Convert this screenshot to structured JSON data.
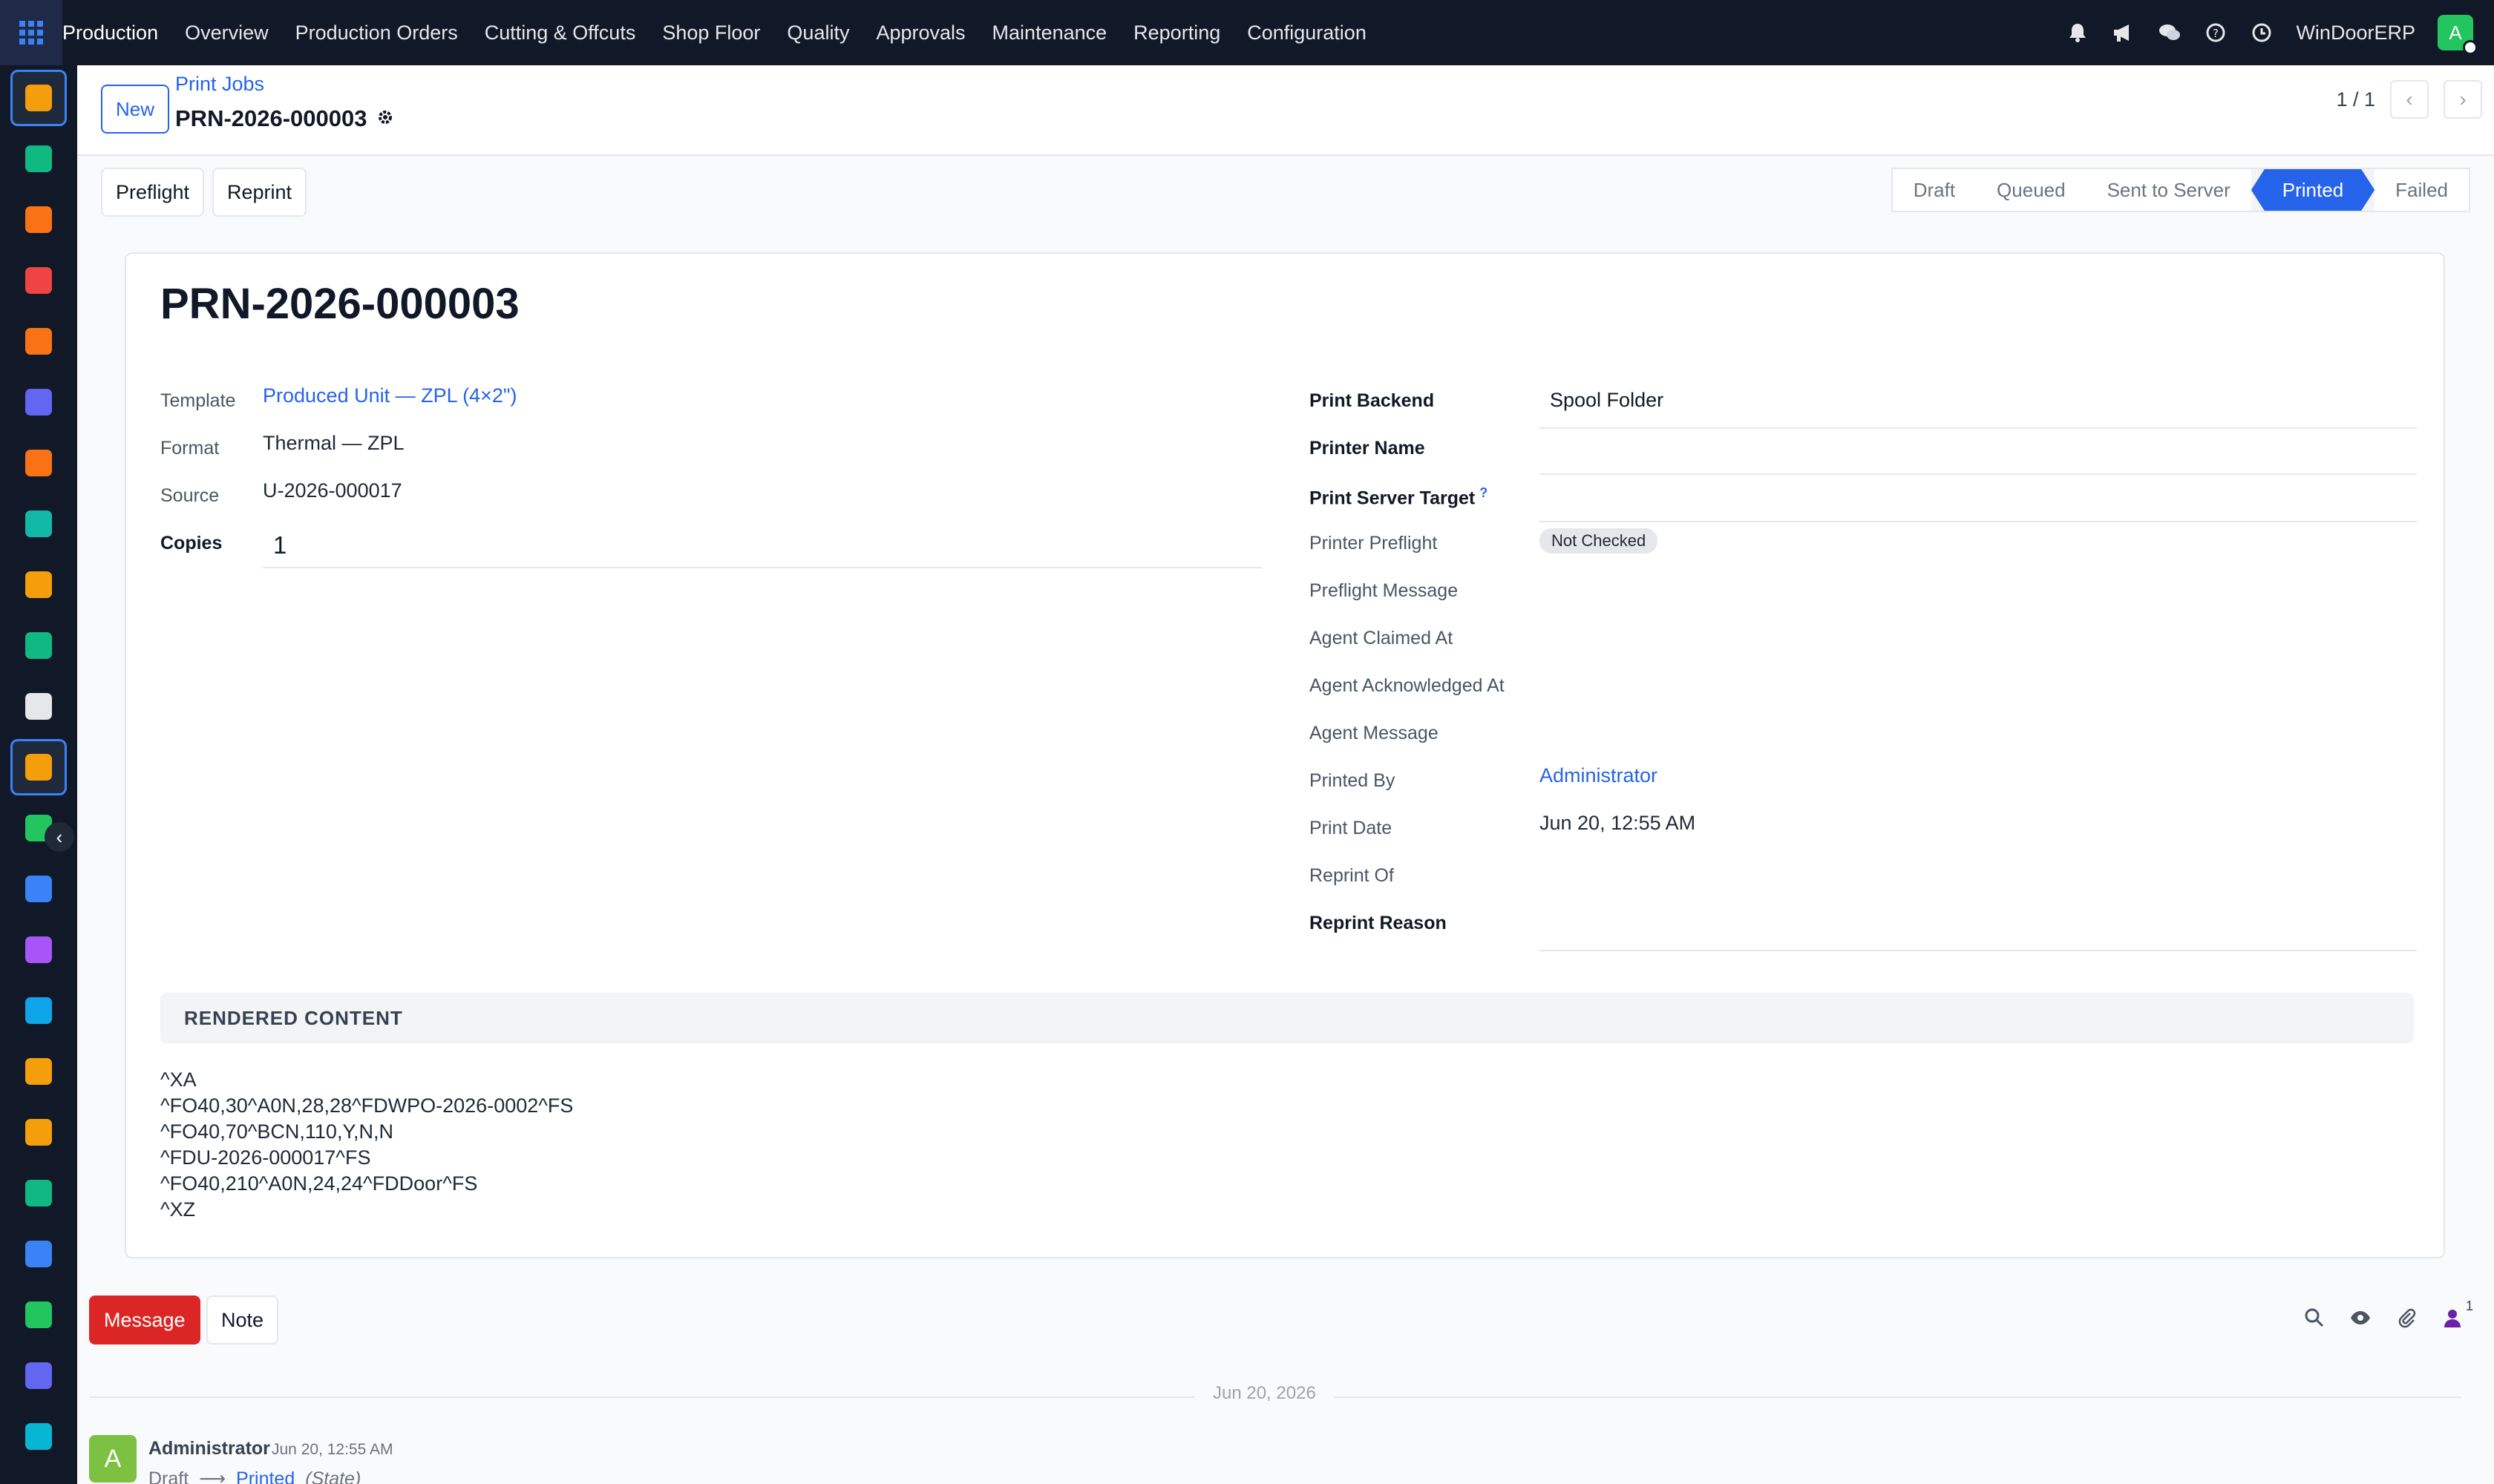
{
  "navbar": {
    "brand": "Production",
    "menu": [
      "Overview",
      "Production Orders",
      "Cutting & Offcuts",
      "Shop Floor",
      "Quality",
      "Approvals",
      "Maintenance",
      "Reporting",
      "Configuration"
    ],
    "company": "WinDoorERP",
    "user_initial": "A"
  },
  "dock": {
    "apps": [
      {
        "icon": "production-app-icon",
        "color": "#f59e0b"
      },
      {
        "icon": "contacts-app-icon",
        "color": "#10b981"
      },
      {
        "icon": "reporting-app-icon",
        "color": "#f97316"
      },
      {
        "icon": "dashboard-app-icon",
        "color": "#ef4444"
      },
      {
        "icon": "discuss-app-icon",
        "color": "#f97316"
      },
      {
        "icon": "mail-app-icon",
        "color": "#6366f1"
      },
      {
        "icon": "chat-app-icon",
        "color": "#f97316"
      },
      {
        "icon": "quality-app-icon",
        "color": "#14b8a6"
      },
      {
        "icon": "stats-app-icon",
        "color": "#f59e0b"
      },
      {
        "icon": "employees-app-icon",
        "color": "#10b981"
      },
      {
        "icon": "inventory-app-icon",
        "color": "#e5e7eb"
      },
      {
        "icon": "print-app-icon",
        "color": "#f59e0b"
      },
      {
        "icon": "todo-app-icon",
        "color": "#22c55e"
      },
      {
        "icon": "knowledge-app-icon",
        "color": "#3b82f6"
      },
      {
        "icon": "packages-app-icon",
        "color": "#a855f7"
      },
      {
        "icon": "invoicing-app-icon",
        "color": "#0ea5e9"
      },
      {
        "icon": "team-app-icon",
        "color": "#f59e0b"
      },
      {
        "icon": "calendar-app-icon",
        "color": "#f59e0b"
      },
      {
        "icon": "sign-app-icon",
        "color": "#10b981"
      },
      {
        "icon": "apps-app-icon",
        "color": "#3b82f6"
      },
      {
        "icon": "whatsapp-app-icon",
        "color": "#22c55e"
      },
      {
        "icon": "timer-app-icon",
        "color": "#6366f1"
      },
      {
        "icon": "website-app-icon",
        "color": "#06b6d4"
      }
    ]
  },
  "control_panel": {
    "new_label": "New",
    "breadcrumb": "Print Jobs",
    "record_name": "PRN-2026-000003",
    "pager": "1 / 1"
  },
  "actions": {
    "preflight_label": "Preflight",
    "reprint_label": "Reprint"
  },
  "statusbar": {
    "stages": [
      "Draft",
      "Queued",
      "Sent to Server",
      "Printed",
      "Failed"
    ],
    "current": "Printed"
  },
  "form": {
    "title": "PRN-2026-000003",
    "left": {
      "template_label": "Template",
      "template_value": "Produced Unit — ZPL (4×2\")",
      "format_label": "Format",
      "format_value": "Thermal — ZPL",
      "source_label": "Source",
      "source_value": "U-2026-000017",
      "copies_label": "Copies",
      "copies_value": "1"
    },
    "right": {
      "print_backend_label": "Print Backend",
      "print_backend_value": "Spool Folder",
      "printer_name_label": "Printer Name",
      "printer_name_value": "",
      "print_server_target_label": "Print Server Target",
      "help_marker": "?",
      "print_server_target_value": "",
      "printer_preflight_label": "Printer Preflight",
      "printer_preflight_value": "Not Checked",
      "preflight_message_label": "Preflight Message",
      "agent_claimed_at_label": "Agent Claimed At",
      "agent_acknowledged_at_label": "Agent Acknowledged At",
      "agent_message_label": "Agent Message",
      "printed_by_label": "Printed By",
      "printed_by_value": "Administrator",
      "print_date_label": "Print Date",
      "print_date_value": "Jun 20, 12:55 AM",
      "reprint_of_label": "Reprint Of",
      "reprint_reason_label": "Reprint Reason",
      "reprint_reason_value": ""
    },
    "rendered_section_title": "RENDERED CONTENT",
    "rendered_lines": [
      "^XA",
      "^FO40,30^A0N,28,28^FDWPO-2026-0002^FS",
      "^FO40,70^BCN,110,Y,N,N",
      "^FDU-2026-000017^FS",
      "^FO40,210^A0N,24,24^FDDoor^FS",
      "^XZ"
    ]
  },
  "chatter": {
    "message_label": "Message",
    "note_label": "Note",
    "follower_count": "1",
    "date_separator": "Jun 20, 2026",
    "messages": [
      {
        "author_initial": "A",
        "author": "Administrator",
        "date": "Jun 20, 12:55 AM",
        "old_value": "Draft",
        "new_value": "Printed",
        "field": "(State)"
      }
    ]
  }
}
